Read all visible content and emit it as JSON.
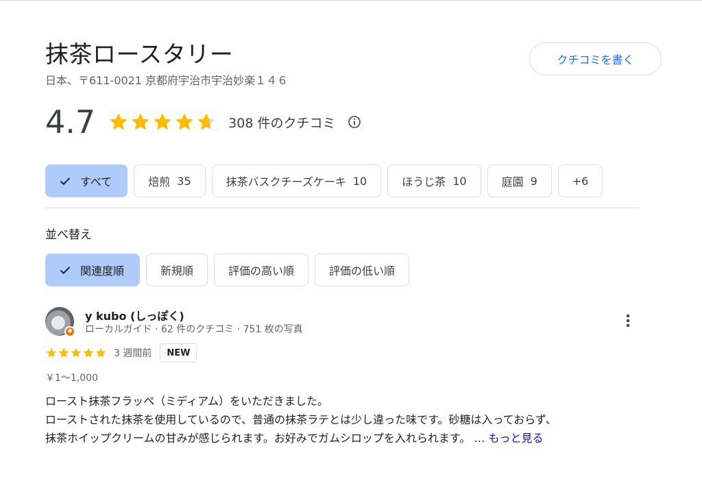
{
  "place": {
    "name": "抹茶ロースタリー",
    "address": "日本、〒611-0021 京都府宇治市宇治妙楽１４６"
  },
  "write_review_label": "クチコミを書く",
  "rating": {
    "value": "4.7",
    "stars_value": 4.7,
    "review_count": "308 件のクチコミ"
  },
  "filters": [
    {
      "label": "すべて",
      "count": "",
      "selected": true
    },
    {
      "label": "焙煎",
      "count": "35"
    },
    {
      "label": "抹茶バスクチーズケーキ",
      "count": "10"
    },
    {
      "label": "ほうじ茶",
      "count": "10"
    },
    {
      "label": "庭園",
      "count": "9"
    },
    {
      "label": "+6",
      "count": ""
    }
  ],
  "sort": {
    "label": "並べ替え",
    "options": [
      {
        "label": "関連度順",
        "selected": true
      },
      {
        "label": "新規順"
      },
      {
        "label": "評価の高い順"
      },
      {
        "label": "評価の低い順"
      }
    ]
  },
  "review": {
    "name": "y kubo (しっぽく)",
    "meta": "ローカルガイド · 62 件のクチコミ · 751 枚の写真",
    "stars": 5,
    "time_ago": "3 週間前",
    "badge": "NEW",
    "price": "￥1〜1,000",
    "text_line1": "ロースト抹茶フラッペ（ミディアム）をいただきました。",
    "text_line2": "ローストされた抹茶を使用しているので、普通の抹茶ラテとは少し違った味です。砂糖は入っておらず、",
    "text_line3": "抹茶ホイップクリームの甘みが感じられます。お好みでガムシロップを入れられます。",
    "ellipsis": " … ",
    "more_label": "もっと見る"
  },
  "colors": {
    "star": "#fbbc04",
    "star_empty": "#dadce0",
    "accent": "#1a73e8",
    "chip_selected": "#aecbfa"
  }
}
